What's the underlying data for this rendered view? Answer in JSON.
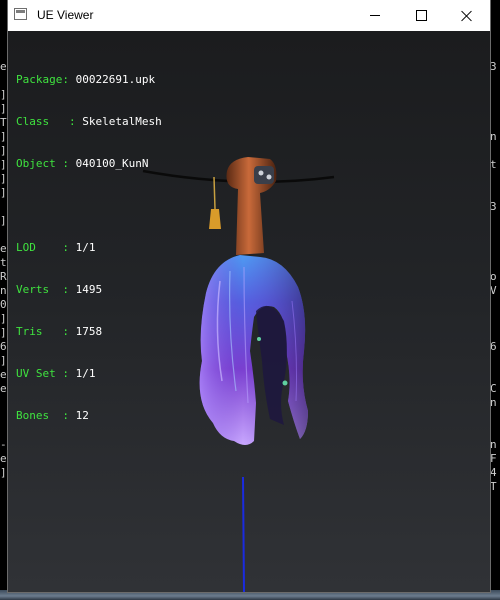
{
  "window": {
    "title": "UE Viewer"
  },
  "info_panel": {
    "header": [
      {
        "key": "Package",
        "value": "00022691.upk"
      },
      {
        "key": "Class",
        "value": "SkeletalMesh"
      },
      {
        "key": "Object",
        "value": "040100_KunN"
      }
    ],
    "stats": [
      {
        "key": "LOD",
        "value": "1/1"
      },
      {
        "key": "Verts",
        "value": "1495"
      },
      {
        "key": "Tris",
        "value": "1758"
      },
      {
        "key": "UV Set",
        "value": "1/1"
      },
      {
        "key": "Bones",
        "value": "12"
      }
    ]
  },
  "background_console": {
    "left": [
      "e",
      "",
      "]",
      "]",
      "T",
      "]",
      "]",
      "]",
      "]",
      "]",
      "",
      "]",
      "",
      "e",
      "t",
      "R",
      "n",
      "0",
      "]",
      "]",
      "6",
      "]",
      "e",
      "e",
      "",
      "",
      "",
      "-",
      "e",
      "]"
    ],
    "right": [
      "3",
      "",
      "",
      "",
      "",
      "n",
      "",
      "t",
      "",
      "",
      "3",
      "",
      "",
      "",
      "",
      "o",
      "V",
      "",
      "",
      "",
      "6",
      "",
      "",
      "C",
      "n",
      "",
      "",
      "n",
      "F",
      "4",
      "T"
    ]
  },
  "colors": {
    "info_key": "#3fe33f",
    "info_value": "#ffffff",
    "viewport_top": "#1b1c1e",
    "viewport_bottom": "#303236",
    "hair_top": "#5aa0f0",
    "hair_bottom": "#7a3fd0",
    "bone_line": "#1a2be0"
  }
}
